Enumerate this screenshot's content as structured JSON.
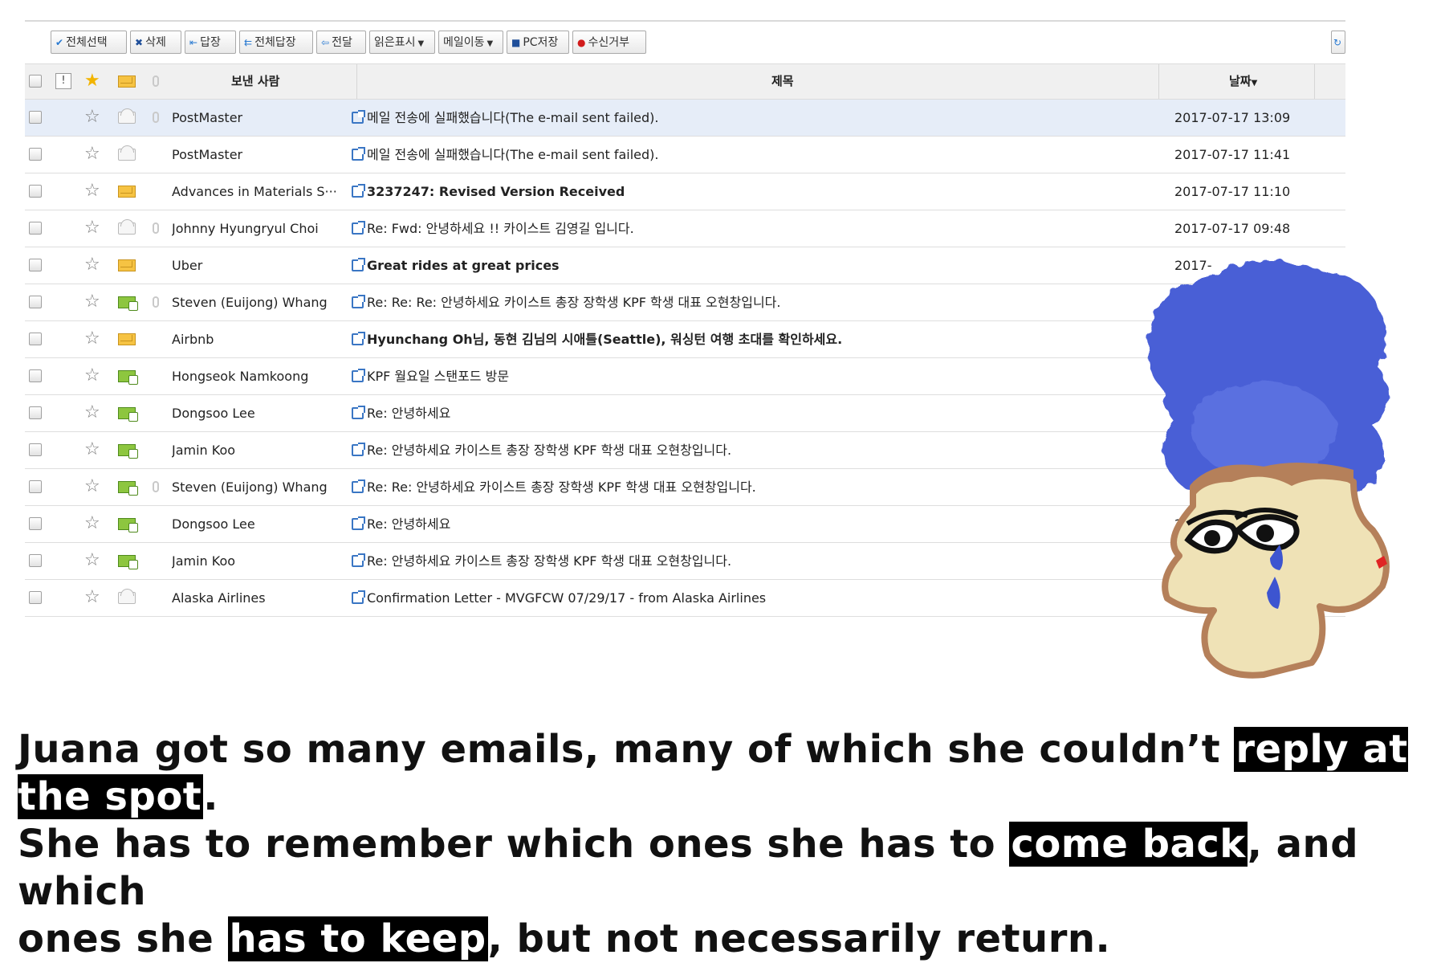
{
  "toolbar": {
    "buttons": [
      {
        "label": "전체선택",
        "icon": "check-icon"
      },
      {
        "label": "삭제",
        "icon": "x-icon"
      },
      {
        "label": "답장",
        "icon": "reply-icon"
      },
      {
        "label": "전체답장",
        "icon": "reply-all-icon"
      },
      {
        "label": "전달",
        "icon": "forward-icon"
      },
      {
        "label": "읽은표시",
        "icon": "dropdown-caret-icon"
      },
      {
        "label": "메일이동",
        "icon": "dropdown-caret-icon"
      },
      {
        "label": "PC저장",
        "icon": "save-icon"
      },
      {
        "label": "수신거부",
        "icon": "block-icon"
      }
    ]
  },
  "header": {
    "sender": "보낸 사람",
    "subject": "제목",
    "date": "날짜"
  },
  "emails": [
    {
      "sender": "PostMaster",
      "subject": "메일 전송에 실패했습니다(The e-mail sent failed).",
      "date": "2017-07-17 13:09",
      "status": "read",
      "attachment": true,
      "bold": false,
      "selected": true
    },
    {
      "sender": "PostMaster",
      "subject": "메일 전송에 실패했습니다(The e-mail sent failed).",
      "date": "2017-07-17 11:41",
      "status": "read",
      "attachment": false,
      "bold": false,
      "selected": false
    },
    {
      "sender": "Advances in Materials S···",
      "subject": "3237247: Revised Version Received",
      "date": "2017-07-17 11:10",
      "status": "unread",
      "attachment": false,
      "bold": true,
      "selected": false
    },
    {
      "sender": "Johnny Hyungryul Choi",
      "subject": "Re: Fwd: 안녕하세요 !! 카이스트 김영길 입니다.",
      "date": "2017-07-17 09:48",
      "status": "read",
      "attachment": true,
      "bold": false,
      "selected": false
    },
    {
      "sender": "Uber",
      "subject": "Great rides at great prices",
      "date": "2017-",
      "status": "unread",
      "attachment": false,
      "bold": true,
      "selected": false
    },
    {
      "sender": "Steven (Euijong) Whang",
      "subject": "Re: Re: Re: 안녕하세요 카이스트 총장 장학생 KPF 학생 대표 오현창입니다.",
      "date": "2",
      "status": "replied",
      "attachment": true,
      "bold": false,
      "selected": false
    },
    {
      "sender": "Airbnb",
      "subject": "Hyunchang Oh님, 동현 김님의 시애틀(Seattle), 워싱턴 여행 초대를 확인하세요.",
      "date": "",
      "status": "unread",
      "attachment": false,
      "bold": true,
      "selected": false
    },
    {
      "sender": "Hongseok Namkoong",
      "subject": "KPF 월요일 스탠포드 방문",
      "date": "",
      "status": "replied",
      "attachment": false,
      "bold": false,
      "selected": false
    },
    {
      "sender": "Dongsoo Lee",
      "subject": "Re: 안녕하세요",
      "date": "",
      "status": "replied",
      "attachment": false,
      "bold": false,
      "selected": false
    },
    {
      "sender": "Jamin Koo",
      "subject": "Re: 안녕하세요 카이스트 총장 장학생 KPF 학생 대표 오현창입니다.",
      "date": "",
      "status": "replied",
      "attachment": false,
      "bold": false,
      "selected": false
    },
    {
      "sender": "Steven (Euijong) Whang",
      "subject": "Re: Re: 안녕하세요 카이스트 총장 장학생 KPF 학생 대표 오현창입니다.",
      "date": "",
      "status": "replied",
      "attachment": true,
      "bold": false,
      "selected": false
    },
    {
      "sender": "Dongsoo Lee",
      "subject": "Re: 안녕하세요",
      "date": "2",
      "status": "replied",
      "attachment": false,
      "bold": false,
      "selected": false
    },
    {
      "sender": "Jamin Koo",
      "subject": "Re: 안녕하세요 카이스트 총장 장학생 KPF 학생 대표 오현창입니다.",
      "date": "",
      "status": "replied",
      "attachment": false,
      "bold": false,
      "selected": false
    },
    {
      "sender": "Alaska Airlines",
      "subject": "Confirmation Letter - MVGFCW 07/29/17 - from Alaska Airlines",
      "date": "",
      "status": "read",
      "attachment": false,
      "bold": false,
      "selected": false
    }
  ],
  "caption": {
    "line1_pre": "Juana got so many emails, many of which she couldn’t ",
    "line1_hl": "reply at the spot",
    "line1_post": ".",
    "line2_pre": "She has to remember which ones she has to ",
    "line2_hl": "come back",
    "line2_post": ", and which",
    "line3_pre": "ones she ",
    "line3_hl": "has to keep",
    "line3_post": ", but not necessarily return."
  },
  "colors": {
    "selected_row": "#e6edf8",
    "header_bg": "#f0f0f0",
    "avatar_hair": "#4a5fd6",
    "avatar_skin": "#efe2b6",
    "avatar_outline": "#b5805a",
    "tear": "#3d55d0"
  }
}
